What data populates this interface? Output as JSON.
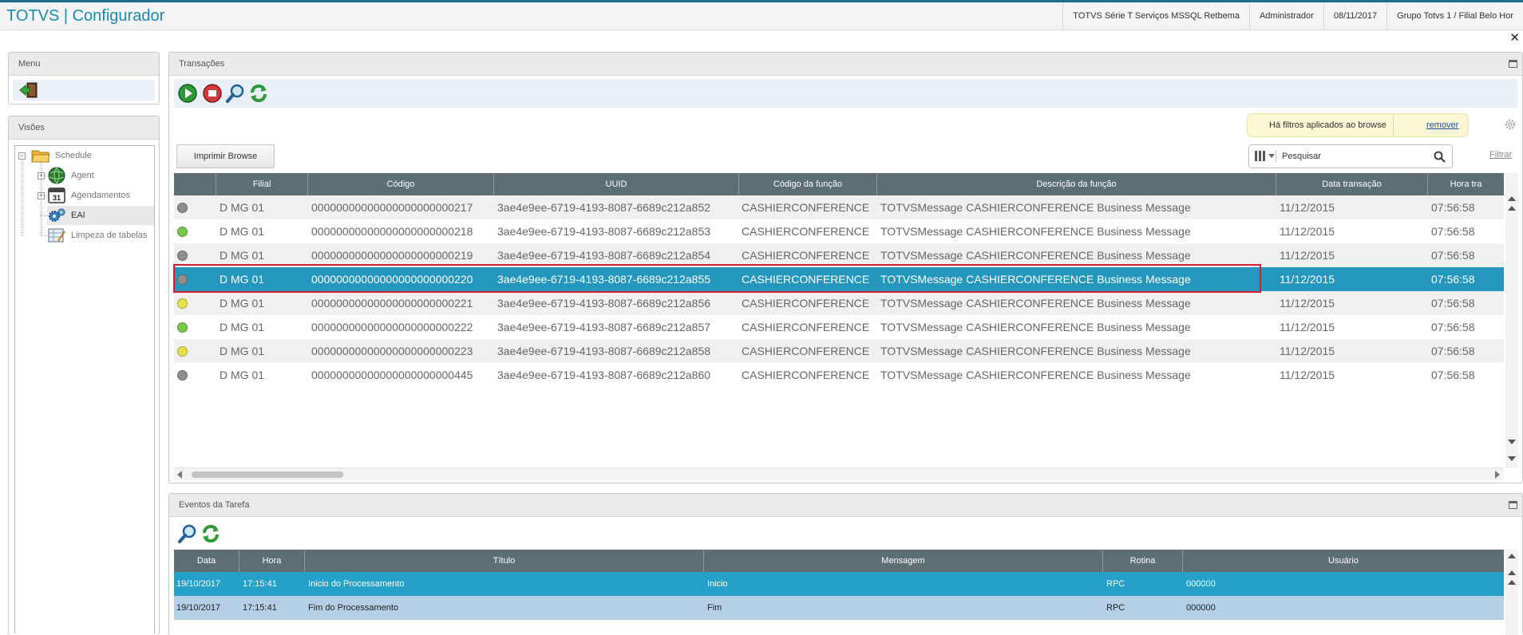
{
  "header": {
    "app_title": "TOTVS | Configurador",
    "environment": "TOTVS Série T Serviços MSSQL Retbema",
    "user": "Administrador",
    "date": "08/11/2017",
    "company": "Grupo Totvs 1 / Filial Belo Hor",
    "close_symbol": "✕"
  },
  "menu": {
    "title": "Menu"
  },
  "visoes": {
    "title": "Visões",
    "tree": [
      {
        "label": "Schedule",
        "icon": "folder-icon"
      },
      {
        "label": "Agent",
        "icon": "globe-icon"
      },
      {
        "label": "Agendamentos",
        "icon": "calendar-icon"
      },
      {
        "label": "EAI",
        "icon": "gears-icon"
      },
      {
        "label": "Limpeza de tabelas",
        "icon": "clean-table-icon"
      }
    ],
    "calendar_day": "31"
  },
  "transacoes": {
    "title": "Transações",
    "filter_notice": "Há filtros aplicados ao browse",
    "filter_remove": "remover",
    "print_label": "Imprimir Browse",
    "search_placeholder": "Pesquisar",
    "filter_link": "Filtrar",
    "columns": [
      "",
      "Filial",
      "Código",
      "UUID",
      "Código da função",
      "Descrição da função",
      "Data transação",
      "Hora tra"
    ],
    "rows": [
      {
        "status": "gray",
        "filial": "D MG 01",
        "codigo": "00000000000000000000000217",
        "uuid": "3ae4e9ee-6719-4193-8087-6689c212a852",
        "funcao": "CASHIERCONFERENCE",
        "descricao": "TOTVSMessage CASHIERCONFERENCE Business Message",
        "data": "11/12/2015",
        "hora": "07:56:58"
      },
      {
        "status": "green",
        "filial": "D MG 01",
        "codigo": "00000000000000000000000218",
        "uuid": "3ae4e9ee-6719-4193-8087-6689c212a853",
        "funcao": "CASHIERCONFERENCE",
        "descricao": "TOTVSMessage CASHIERCONFERENCE Business Message",
        "data": "11/12/2015",
        "hora": "07:56:58"
      },
      {
        "status": "gray",
        "filial": "D MG 01",
        "codigo": "00000000000000000000000219",
        "uuid": "3ae4e9ee-6719-4193-8087-6689c212a854",
        "funcao": "CASHIERCONFERENCE",
        "descricao": "TOTVSMessage CASHIERCONFERENCE Business Message",
        "data": "11/12/2015",
        "hora": "07:56:58"
      },
      {
        "status": "gray",
        "filial": "D MG 01",
        "codigo": "00000000000000000000000220",
        "uuid": "3ae4e9ee-6719-4193-8087-6689c212a855",
        "funcao": "CASHIERCONFERENCE",
        "descricao": "TOTVSMessage CASHIERCONFERENCE Business Message",
        "data": "11/12/2015",
        "hora": "07:56:58",
        "selected": true
      },
      {
        "status": "yellow",
        "filial": "D MG 01",
        "codigo": "00000000000000000000000221",
        "uuid": "3ae4e9ee-6719-4193-8087-6689c212a856",
        "funcao": "CASHIERCONFERENCE",
        "descricao": "TOTVSMessage CASHIERCONFERENCE Business Message",
        "data": "11/12/2015",
        "hora": "07:56:58"
      },
      {
        "status": "green",
        "filial": "D MG 01",
        "codigo": "00000000000000000000000222",
        "uuid": "3ae4e9ee-6719-4193-8087-6689c212a857",
        "funcao": "CASHIERCONFERENCE",
        "descricao": "TOTVSMessage CASHIERCONFERENCE Business Message",
        "data": "11/12/2015",
        "hora": "07:56:58"
      },
      {
        "status": "yellow",
        "filial": "D MG 01",
        "codigo": "00000000000000000000000223",
        "uuid": "3ae4e9ee-6719-4193-8087-6689c212a858",
        "funcao": "CASHIERCONFERENCE",
        "descricao": "TOTVSMessage CASHIERCONFERENCE Business Message",
        "data": "11/12/2015",
        "hora": "07:56:58"
      },
      {
        "status": "gray",
        "filial": "D MG 01",
        "codigo": "00000000000000000000000445",
        "uuid": "3ae4e9ee-6719-4193-8087-6689c212a860",
        "funcao": "CASHIERCONFERENCE",
        "descricao": "TOTVSMessage CASHIERCONFERENCE Business Message",
        "data": "11/12/2015",
        "hora": "07:56:58"
      }
    ]
  },
  "eventos": {
    "title": "Eventos da Tarefa",
    "columns": [
      "Data",
      "Hora",
      "Título",
      "Mensagem",
      "Rotina",
      "Usuário"
    ],
    "rows": [
      {
        "data": "19/10/2017",
        "hora": "17:15:41",
        "titulo": "Inicio do Processamento",
        "mensagem": "Inicio",
        "rotina": "RPC",
        "usuario": "000000"
      },
      {
        "data": "19/10/2017",
        "hora": "17:15:41",
        "titulo": "Fim do Processamento",
        "mensagem": "Fim",
        "rotina": "RPC",
        "usuario": "000000"
      }
    ]
  },
  "colors": {
    "brand": "#1a8bb0",
    "grid_header": "#5d6f73",
    "selected_row": "#2597bf",
    "selection_outline": "#d0202e",
    "status_gray": "#8e8e8e",
    "status_green": "#7dc54a",
    "status_yellow": "#e6e04a"
  }
}
